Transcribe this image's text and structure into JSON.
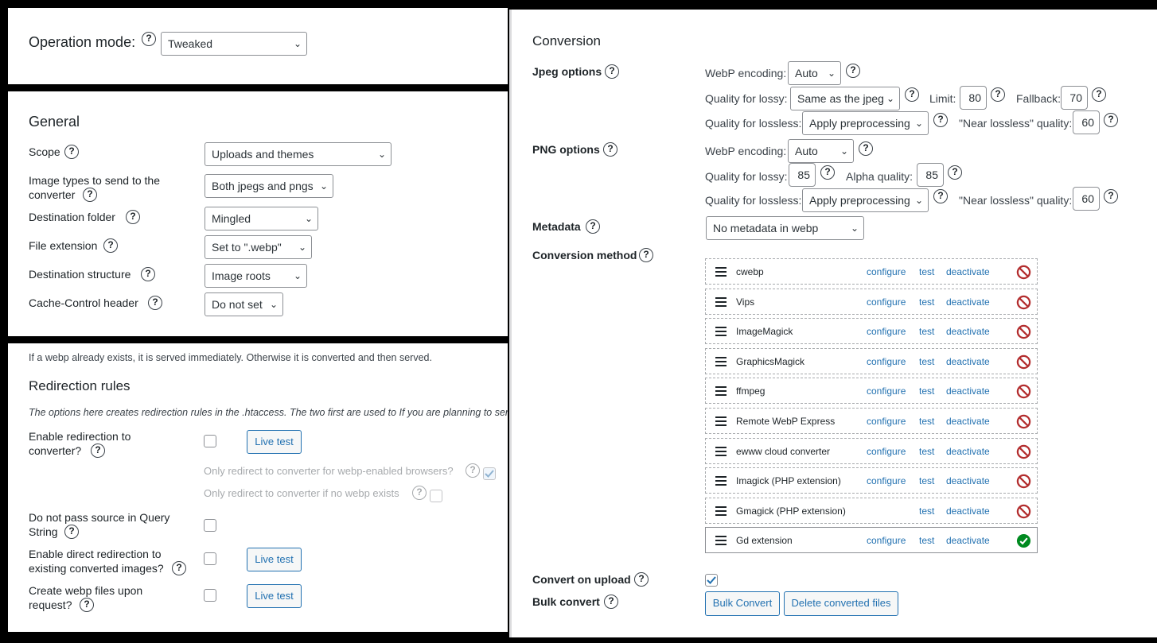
{
  "op": {
    "label": "Operation mode:",
    "value": "Tweaked"
  },
  "general": {
    "title": "General",
    "scope": {
      "label": "Scope",
      "value": "Uploads and themes"
    },
    "types": {
      "label1": "Image types to send to the",
      "label2": "converter",
      "value": "Both jpegs and pngs"
    },
    "dest": {
      "label": "Destination folder",
      "value": "Mingled"
    },
    "ext": {
      "label": "File extension",
      "value": "Set to \".webp\""
    },
    "struct": {
      "label": "Destination structure",
      "value": "Image roots"
    },
    "cache": {
      "label": "Cache-Control header",
      "value": "Do not set"
    }
  },
  "redir": {
    "intro": "If a webp already exists, it is served immediately. Otherwise it is converted and then served.",
    "title": "Redirection rules",
    "desc": "The options here creates redirection rules in the .htaccess. The two first are used to If you are planning to ser",
    "enable1": "Enable redirection to",
    "enable2": "converter?",
    "only1": "Only redirect to converter for webp-enabled browsers?",
    "only2": "Only redirect to converter if no webp exists",
    "nopass1": "Do not pass source in Query",
    "nopass2": "String",
    "direct1": "Enable direct redirection to",
    "direct2": "existing converted images?",
    "create1": "Create webp files upon",
    "create2": "request?",
    "live": "Live test"
  },
  "conv": {
    "title": "Conversion",
    "jpeg": {
      "label": "Jpeg options",
      "enc_label": "WebP encoding:",
      "enc": "Auto",
      "lossy_label": "Quality for lossy:",
      "lossy": "Same as the jpeg",
      "limit_label": "Limit:",
      "limit": "80",
      "fallback_label": "Fallback:",
      "fallback": "70",
      "lossless_label": "Quality for lossless:",
      "lossless": "Apply preprocessing",
      "near_label": "\"Near lossless\" quality:",
      "near": "60"
    },
    "png": {
      "label": "PNG options",
      "enc_label": "WebP encoding:",
      "enc": "Auto",
      "lossy_label": "Quality for lossy:",
      "lossy": "85",
      "alpha_label": "Alpha quality:",
      "alpha": "85",
      "lossless_label": "Quality for lossless:",
      "lossless": "Apply preprocessing",
      "near_label": "\"Near lossless\" quality:",
      "near": "60"
    },
    "meta": {
      "label": "Metadata",
      "value": "No metadata in webp"
    },
    "method_label": "Conversion method",
    "configure": "configure",
    "test": "test",
    "deactivate": "deactivate",
    "methods": [
      "cwebp",
      "Vips",
      "ImageMagick",
      "GraphicsMagick",
      "ffmpeg",
      "Remote WebP Express",
      "ewww cloud converter",
      "Imagick (PHP extension)",
      "Gmagick (PHP extension)",
      "Gd extension"
    ],
    "upload_label": "Convert on upload",
    "bulk_label": "Bulk convert",
    "bulk_btn": "Bulk Convert",
    "delete_btn": "Delete converted files"
  },
  "colors": {
    "link": "#2271b1",
    "blocked": "#b32d2e",
    "ok": "#008a20"
  }
}
